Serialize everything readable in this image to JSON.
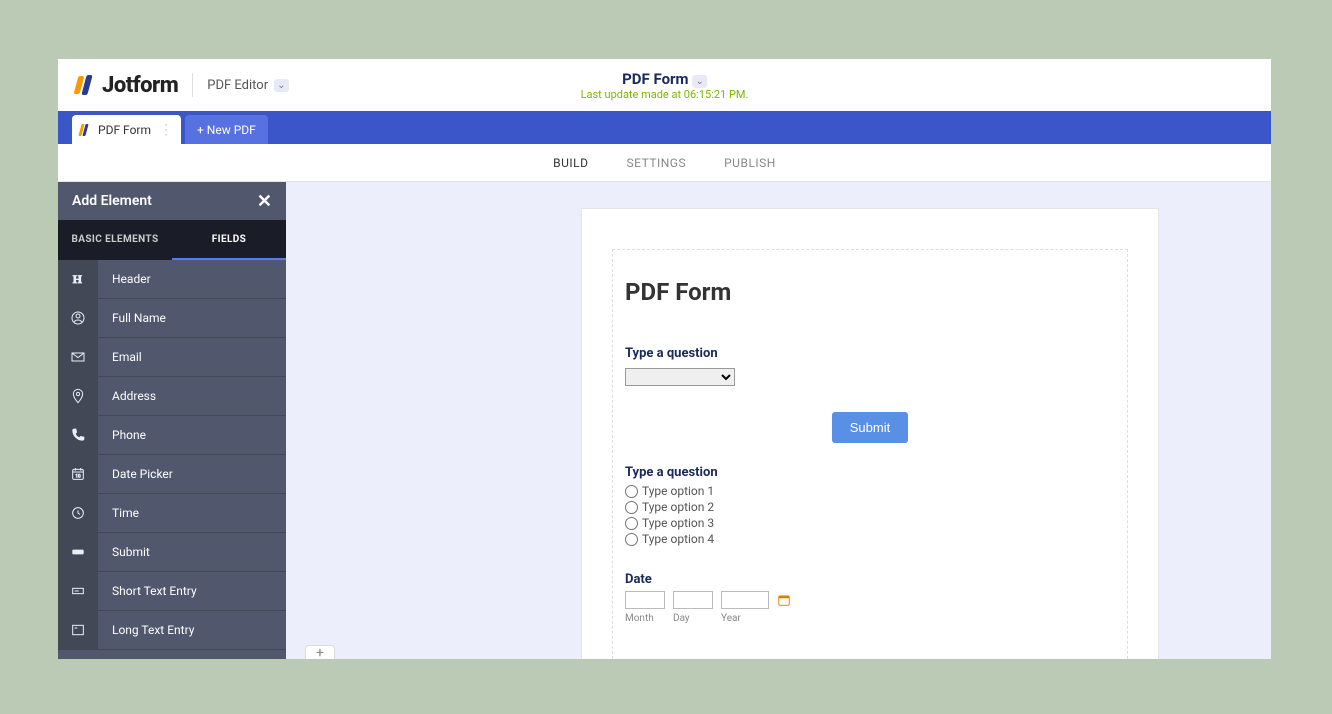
{
  "header": {
    "brand": "Jotform",
    "editor_label": "PDF Editor",
    "title": "PDF Form",
    "subtitle": "Last update made at 06:15:21 PM."
  },
  "tabs": {
    "active": "PDF Form",
    "new_pdf": "+ New PDF"
  },
  "subnav": {
    "build": "BUILD",
    "settings": "SETTINGS",
    "publish": "PUBLISH"
  },
  "panel": {
    "title": "Add Element",
    "tab_basic": "BASIC ELEMENTS",
    "tab_fields": "FIELDS",
    "items": [
      {
        "label": "Header"
      },
      {
        "label": "Full Name"
      },
      {
        "label": "Email"
      },
      {
        "label": "Address"
      },
      {
        "label": "Phone"
      },
      {
        "label": "Date Picker"
      },
      {
        "label": "Time"
      },
      {
        "label": "Submit"
      },
      {
        "label": "Short Text Entry"
      },
      {
        "label": "Long Text Entry"
      }
    ]
  },
  "form": {
    "title": "PDF Form",
    "q1_label": "Type a question",
    "submit_label": "Submit",
    "q2_label": "Type a question",
    "q2_options": [
      "Type option 1",
      "Type option 2",
      "Type option 3",
      "Type option 4"
    ],
    "date_label": "Date",
    "date_month": "Month",
    "date_day": "Day",
    "date_year": "Year"
  }
}
